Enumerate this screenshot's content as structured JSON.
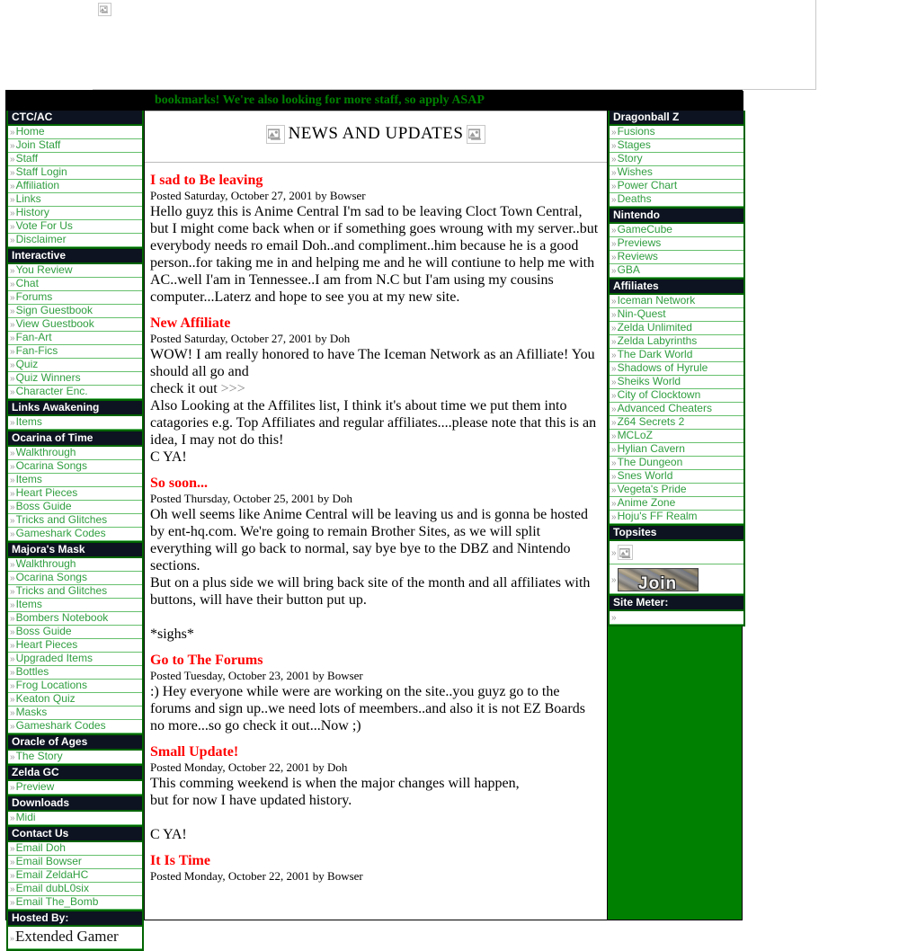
{
  "colors": {
    "page_bg": "#ffffff",
    "frame_green": "#008000",
    "menu_head_bg": "#0d1320",
    "menu_link": "#2f9e3f",
    "menu_border": "#006400",
    "marquee_text": "#008000",
    "post_title": "#ff0000"
  },
  "banner": {
    "broken_image_alt": "broken-image"
  },
  "marquee": {
    "text": "bookmarks! We're also looking for more staff, so apply ASAP"
  },
  "left_menu": [
    {
      "heading": "CTC/AC",
      "items": [
        "Home",
        "Join Staff",
        "Staff",
        "Staff Login",
        "Affiliation",
        "Links",
        "History",
        "Vote For Us",
        "Disclaimer"
      ]
    },
    {
      "heading": "Interactive",
      "items": [
        "You Review",
        "Chat",
        "Forums",
        "Sign Guestbook",
        "View Guestbook",
        "Fan-Art",
        "Fan-Fics",
        "Quiz",
        "Quiz Winners",
        "Character Enc."
      ]
    },
    {
      "heading": "Links Awakening",
      "items": [
        "Items"
      ]
    },
    {
      "heading": "Ocarina of Time",
      "items": [
        "Walkthrough",
        "Ocarina Songs",
        "Items",
        "Heart Pieces",
        "Boss Guide",
        "Tricks and Glitches",
        "Gameshark Codes"
      ]
    },
    {
      "heading": "Majora's Mask",
      "items": [
        "Walkthrough",
        "Ocarina Songs",
        "Tricks and Glitches",
        "Items",
        "Bombers Notebook",
        "Boss Guide",
        "Heart Pieces",
        "Upgraded Items",
        "Bottles",
        "Frog Locations",
        "Keaton Quiz",
        "Masks",
        "Gameshark Codes"
      ]
    },
    {
      "heading": "Oracle of Ages",
      "items": [
        "The Story"
      ]
    },
    {
      "heading": "Zelda GC",
      "items": [
        "Preview"
      ]
    },
    {
      "heading": "Downloads",
      "items": [
        "Midi"
      ]
    },
    {
      "heading": "Contact Us",
      "items": [
        "Email Doh",
        "Email Bowser",
        "Email ZeldaHC",
        "Email dubL0six",
        "Email The_Bomb"
      ]
    },
    {
      "heading": "Hosted By:",
      "items": [
        "Extended Gamer"
      ]
    }
  ],
  "right_menu": [
    {
      "heading": "Dragonball Z",
      "items": [
        "Fusions",
        "Stages",
        "Story",
        "Wishes",
        "Power Chart",
        "Deaths"
      ]
    },
    {
      "heading": "Nintendo",
      "items": [
        "GameCube",
        "Previews",
        "Reviews",
        "GBA"
      ]
    },
    {
      "heading": "Affiliates",
      "items": [
        "Iceman Network",
        "Nin-Quest",
        "Zelda Unlimited",
        "Zelda Labyrinths",
        "The Dark World",
        "Shadows of Hyrule",
        "Sheiks World",
        "City of Clocktown",
        "Advanced Cheaters",
        "Z64 Secrets 2",
        "MCLoZ",
        "Hylian Cavern",
        "The Dungeon",
        "Snes World",
        "Vegeta's Pride",
        "Anime Zone",
        "Hoju's FF Realm"
      ]
    },
    {
      "heading": "Topsites",
      "items": []
    },
    {
      "heading": "Site Meter:",
      "items": []
    }
  ],
  "topsites": {
    "join_label": "Join"
  },
  "main": {
    "news_header": "NEWS AND UPDATES",
    "posts": [
      {
        "title": "I sad to Be leaving",
        "meta": "Posted Saturday, October 27, 2001 by Bowser",
        "body": "Hello guyz this is Anime Central I'm sad to be leaving Cloct Town Central, but I might come back when or if something goes wroung with my server..but everybody needs ro email Doh..and compliment..him because he is a good person..for taking me in and helping me and he will contiune to help me with AC..well I'am in Tennessee..I am from N.C but I'am using my cousins computer...Laterz and hope to see you at my new site."
      },
      {
        "title": "New Affiliate",
        "meta": "Posted Saturday, October 27, 2001 by Doh",
        "line1": "WOW! I am really honored to have The Iceman Network as an Afilliate! You should all go and",
        "line2_prefix": "check it out ",
        "line2_link": ">>>",
        "line3": "Also Looking at the Affilites list, I think it's about time we put them into catagories e.g. Top Affiliates and regular affiliates....please note that this is an idea, I may not do this!",
        "line4": "C YA!"
      },
      {
        "title": "So soon...",
        "meta": "Posted Thursday, October 25, 2001 by Doh",
        "line1": "Oh well seems like Anime Central will be leaving us and is gonna be hosted by ent-hq.com. We're going to remain Brother Sites, as we will split everything will go back to normal, say bye bye to the DBZ and Nintendo sections.",
        "line2": "But on a plus side we will bring back site of the month and all affiliates with buttons, will have their button put up.",
        "line3": "*sighs*"
      },
      {
        "title": "Go to The Forums",
        "meta": "Posted Tuesday, October 23, 2001 by Bowser",
        "body": ":) Hey everyone while were are working on the site..you guyz go to the forums and sign up..we need lots of meembers..and also it is not EZ Boards no more...so go check it out...Now ;)"
      },
      {
        "title": "Small Update!",
        "meta": "Posted Monday, October 22, 2001 by Doh",
        "line1": "This comming weekend is when the major changes will happen,",
        "line2": "but for now I have updated history.",
        "line3": "C YA!"
      },
      {
        "title": "It Is Time",
        "meta": "Posted Monday, October 22, 2001 by Bowser",
        "body": ""
      }
    ]
  }
}
